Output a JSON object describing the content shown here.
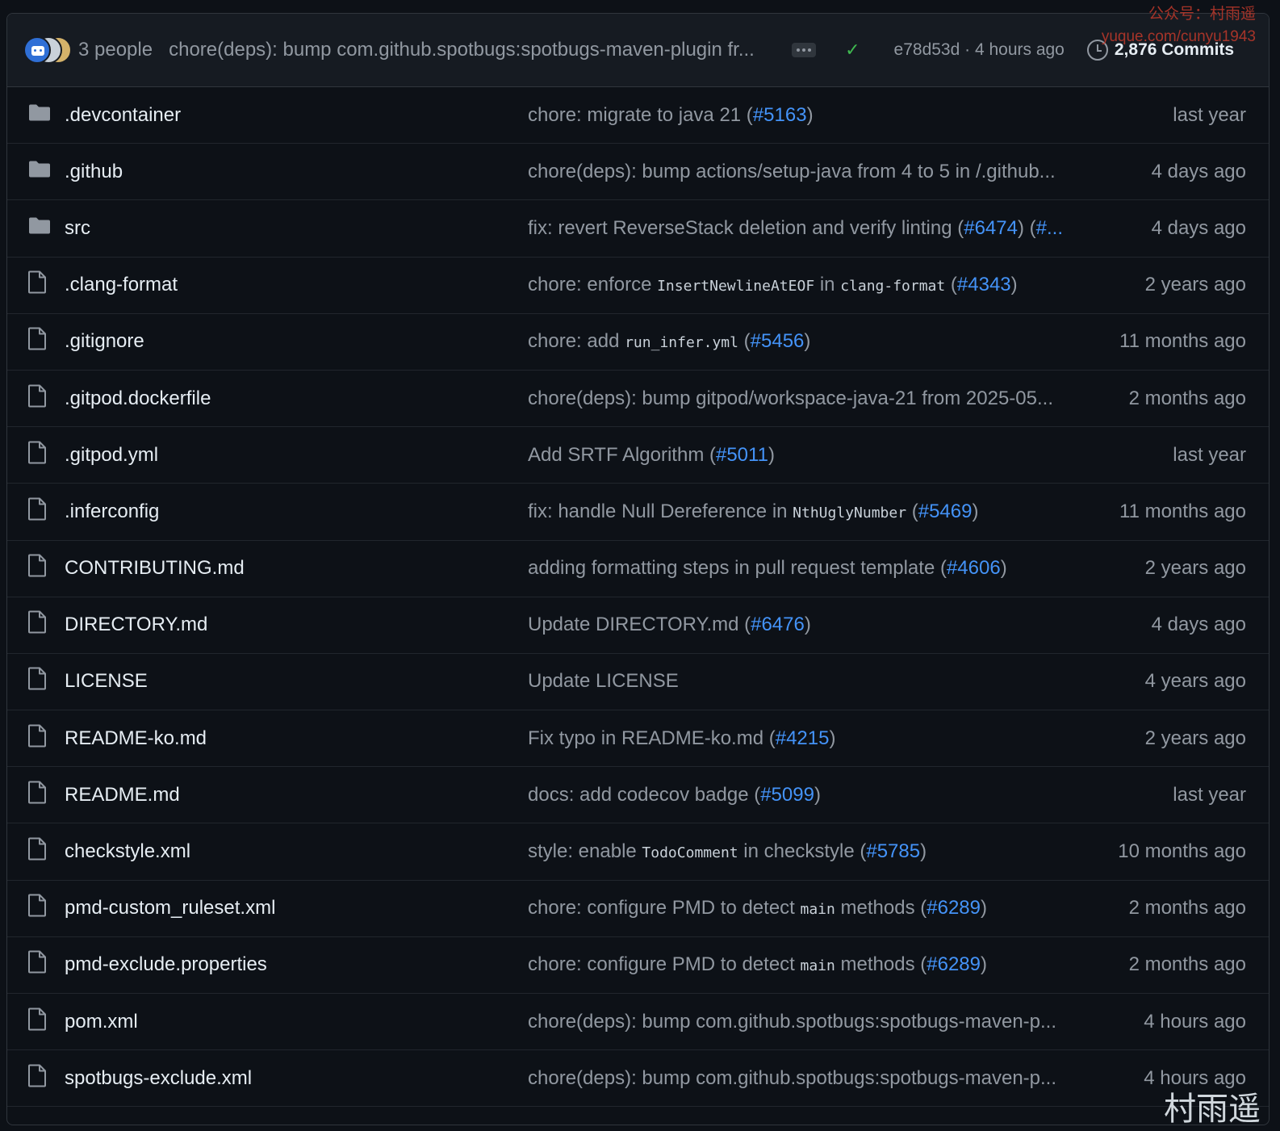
{
  "header": {
    "people": "3 people",
    "commit_message": "chore(deps): bump com.github.spotbugs:spotbugs-maven-plugin fr...",
    "sha_time": "e78d53d · 4 hours ago",
    "commits": "2,876 Commits"
  },
  "rows": [
    {
      "type": "folder",
      "name": ".devcontainer",
      "msg": [
        "chore: migrate to java 21 (",
        {
          "pr": "#5163"
        },
        ")"
      ],
      "when": "last year"
    },
    {
      "type": "folder",
      "name": ".github",
      "msg": [
        "chore(deps): bump actions/setup-java from 4 to 5 in /.github..."
      ],
      "when": "4 days ago"
    },
    {
      "type": "folder",
      "name": "src",
      "msg": [
        "fix: revert ReverseStack deletion and verify linting (",
        {
          "pr": "#6474"
        },
        ") (",
        {
          "pr": "#..."
        }
      ],
      "when": "4 days ago"
    },
    {
      "type": "file",
      "name": ".clang-format",
      "msg": [
        "chore: enforce ",
        {
          "code": "InsertNewlineAtEOF"
        },
        " in ",
        {
          "code": "clang-format"
        },
        " (",
        {
          "pr": "#4343"
        },
        ")"
      ],
      "when": "2 years ago"
    },
    {
      "type": "file",
      "name": ".gitignore",
      "msg": [
        "chore: add ",
        {
          "code": "run_infer.yml"
        },
        " (",
        {
          "pr": "#5456"
        },
        ")"
      ],
      "when": "11 months ago"
    },
    {
      "type": "file",
      "name": ".gitpod.dockerfile",
      "msg": [
        "chore(deps): bump gitpod/workspace-java-21 from 2025-05..."
      ],
      "when": "2 months ago"
    },
    {
      "type": "file",
      "name": ".gitpod.yml",
      "msg": [
        "Add SRTF Algorithm (",
        {
          "pr": "#5011"
        },
        ")"
      ],
      "when": "last year"
    },
    {
      "type": "file",
      "name": ".inferconfig",
      "msg": [
        "fix: handle Null Dereference in ",
        {
          "code": "NthUglyNumber"
        },
        " (",
        {
          "pr": "#5469"
        },
        ")"
      ],
      "when": "11 months ago"
    },
    {
      "type": "file",
      "name": "CONTRIBUTING.md",
      "msg": [
        "adding formatting steps in pull request template (",
        {
          "pr": "#4606"
        },
        ")"
      ],
      "when": "2 years ago"
    },
    {
      "type": "file",
      "name": "DIRECTORY.md",
      "msg": [
        "Update DIRECTORY.md (",
        {
          "pr": "#6476"
        },
        ")"
      ],
      "when": "4 days ago"
    },
    {
      "type": "file",
      "name": "LICENSE",
      "msg": [
        "Update LICENSE"
      ],
      "when": "4 years ago"
    },
    {
      "type": "file",
      "name": "README-ko.md",
      "msg": [
        "Fix typo in README-ko.md (",
        {
          "pr": "#4215"
        },
        ")"
      ],
      "when": "2 years ago"
    },
    {
      "type": "file",
      "name": "README.md",
      "msg": [
        "docs: add codecov badge (",
        {
          "pr": "#5099"
        },
        ")"
      ],
      "when": "last year"
    },
    {
      "type": "file",
      "name": "checkstyle.xml",
      "msg": [
        "style: enable ",
        {
          "code": "TodoComment"
        },
        " in checkstyle (",
        {
          "pr": "#5785"
        },
        ")"
      ],
      "when": "10 months ago"
    },
    {
      "type": "file",
      "name": "pmd-custom_ruleset.xml",
      "msg": [
        "chore: configure PMD to detect ",
        {
          "code": "main"
        },
        " methods (",
        {
          "pr": "#6289"
        },
        ")"
      ],
      "when": "2 months ago"
    },
    {
      "type": "file",
      "name": "pmd-exclude.properties",
      "msg": [
        "chore: configure PMD to detect ",
        {
          "code": "main"
        },
        " methods (",
        {
          "pr": "#6289"
        },
        ")"
      ],
      "when": "2 months ago"
    },
    {
      "type": "file",
      "name": "pom.xml",
      "msg": [
        "chore(deps): bump com.github.spotbugs:spotbugs-maven-p..."
      ],
      "when": "4 hours ago"
    },
    {
      "type": "file",
      "name": "spotbugs-exclude.xml",
      "msg": [
        "chore(deps): bump com.github.spotbugs:spotbugs-maven-p..."
      ],
      "when": "4 hours ago"
    }
  ],
  "watermark": {
    "top_line1": "公众号：村雨遥",
    "top_line2": "yuque.com/cunyu1943",
    "bottom": "村雨遥"
  },
  "colors": {
    "background": "#0d1117",
    "header_bg": "#161b22",
    "border": "#30363d",
    "text": "#e6edf3",
    "muted": "#9198a1",
    "link": "#4493f8",
    "success": "#3fb950"
  },
  "icons": {
    "folder": "folder-icon",
    "file": "file-icon",
    "check": "check-icon",
    "history": "clock-icon"
  }
}
